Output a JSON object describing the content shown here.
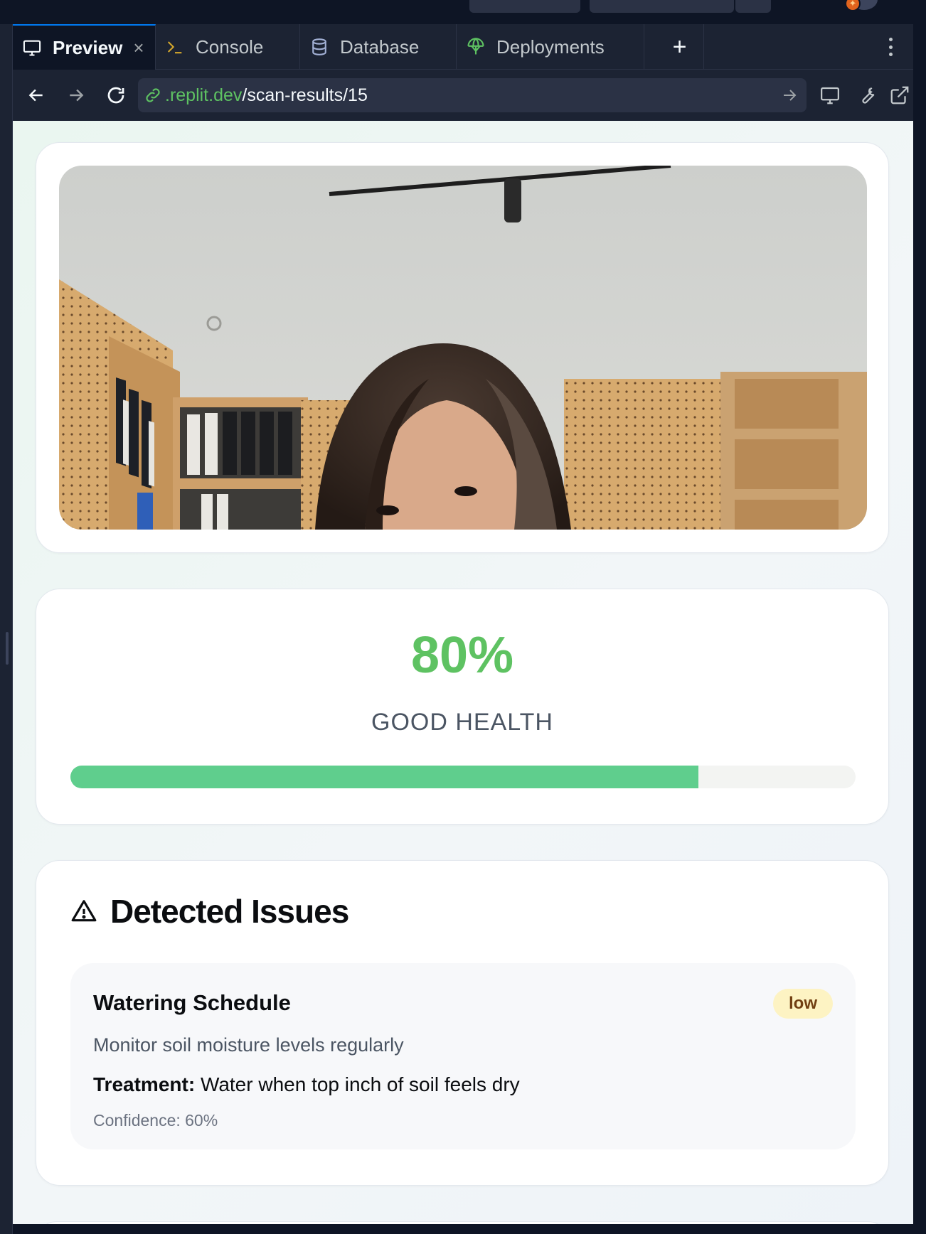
{
  "tabs": [
    {
      "label": "Preview",
      "icon": "monitor-icon",
      "active": true
    },
    {
      "label": "Console",
      "icon": "terminal-icon"
    },
    {
      "label": "Database",
      "icon": "database-icon"
    },
    {
      "label": "Deployments",
      "icon": "deployments-icon"
    }
  ],
  "url": {
    "host": ".replit.dev",
    "path": "/scan-results/15"
  },
  "health": {
    "score_text": "80%",
    "label": "GOOD HEALTH",
    "fraction": 0.8,
    "color": "#5ec262"
  },
  "issues": {
    "title": "Detected Issues",
    "items": [
      {
        "title": "Watering Schedule",
        "severity": "low",
        "description": "Monitor soil moisture levels regularly",
        "treatment_label": "Treatment:",
        "treatment": "Water when top inch of soil feels dry",
        "confidence": "Confidence: 60%"
      }
    ]
  },
  "colors": {
    "accent": "#5ec262",
    "url_host": "#5ec262",
    "active_tab_border": "#0079f2",
    "badge_bg": "#fdf3c3"
  }
}
